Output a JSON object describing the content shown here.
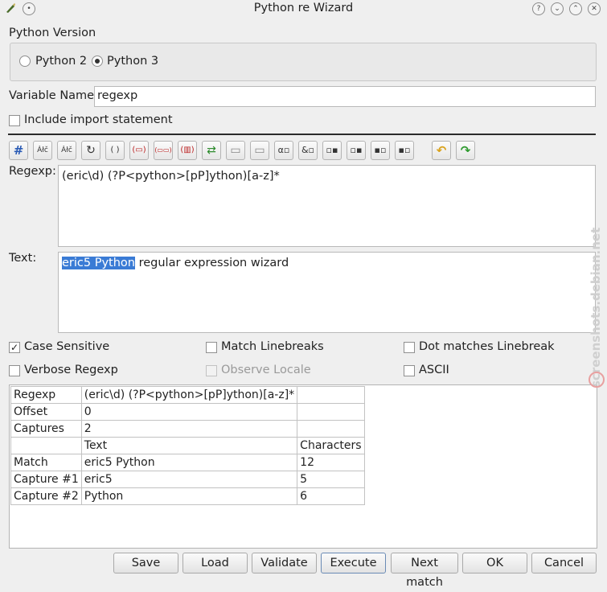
{
  "window": {
    "title": "Python re Wizard",
    "controls": [
      "help-icon",
      "minimize-icon",
      "maximize-icon",
      "close-icon"
    ]
  },
  "version": {
    "group_label": "Python Version",
    "options": [
      {
        "label": "Python 2",
        "selected": false
      },
      {
        "label": "Python 3",
        "selected": true
      }
    ]
  },
  "variable": {
    "label": "Variable Name:",
    "value": "regexp"
  },
  "include_import": {
    "label": "Include import statement",
    "checked": false
  },
  "toolbar": {
    "items": [
      {
        "name": "comment-icon",
        "glyph": "#"
      },
      {
        "name": "characters-icon",
        "glyph": "Ȧłč"
      },
      {
        "name": "character-ranges-icon",
        "glyph": "Ȧłč"
      },
      {
        "name": "repeat-icon",
        "glyph": "↻"
      },
      {
        "name": "group-icon",
        "glyph": "( )"
      },
      {
        "name": "non-capturing-group-icon",
        "glyph": "(▭)"
      },
      {
        "name": "named-group-icon",
        "glyph": "(▭▭)"
      },
      {
        "name": "named-reference-icon",
        "glyph": "(▥)"
      },
      {
        "name": "alternatives-icon",
        "glyph": "⇄"
      },
      {
        "name": "begin-line-icon",
        "glyph": "▭"
      },
      {
        "name": "end-line-icon",
        "glyph": "▭"
      },
      {
        "name": "word-boundary-icon",
        "glyph": "α▫"
      },
      {
        "name": "non-word-boundary-icon",
        "glyph": "&▫"
      },
      {
        "name": "positive-lookahead-icon",
        "glyph": "▫▪"
      },
      {
        "name": "negative-lookahead-icon",
        "glyph": "▫▪"
      },
      {
        "name": "positive-lookbehind-icon",
        "glyph": "▪▫"
      },
      {
        "name": "negative-lookbehind-icon",
        "glyph": "▪▫"
      },
      {
        "name": "undo-icon",
        "glyph": "↶"
      },
      {
        "name": "redo-icon",
        "glyph": "↷"
      }
    ]
  },
  "regexp": {
    "label": "Regexp:",
    "value": "(eric\\d) (?P<python>[pP]ython)[a-z]*"
  },
  "text": {
    "label": "Text:",
    "highlighted": "eric5 Python",
    "rest": " regular expression wizard"
  },
  "options": {
    "case_sensitive": {
      "label": "Case Sensitive",
      "checked": true
    },
    "match_linebreaks": {
      "label": "Match Linebreaks",
      "checked": false
    },
    "dot_matches": {
      "label": "Dot matches Linebreak",
      "checked": false
    },
    "verbose": {
      "label": "Verbose Regexp",
      "checked": false
    },
    "observe_locale": {
      "label": "Observe Locale",
      "checked": false,
      "disabled": true
    },
    "ascii": {
      "label": "ASCII",
      "checked": false
    }
  },
  "results": {
    "rows": [
      [
        "Regexp",
        "(eric\\d) (?P<python>[pP]ython)[a-z]*",
        ""
      ],
      [
        "Offset",
        "0",
        ""
      ],
      [
        "Captures",
        "2",
        ""
      ],
      [
        "",
        "Text",
        "Characters"
      ],
      [
        "Match",
        "eric5 Python",
        "12"
      ],
      [
        "Capture #1",
        "eric5",
        "5"
      ],
      [
        "Capture #2",
        "Python",
        "6"
      ]
    ]
  },
  "buttons": {
    "save": "Save",
    "load": "Load",
    "validate": "Validate",
    "execute": "Execute",
    "next_match": "Next match",
    "ok": "OK",
    "cancel": "Cancel"
  },
  "watermark": "screenshots.debian.net",
  "colors": {
    "selection": "#3a7bd5",
    "background": "#efefef"
  }
}
